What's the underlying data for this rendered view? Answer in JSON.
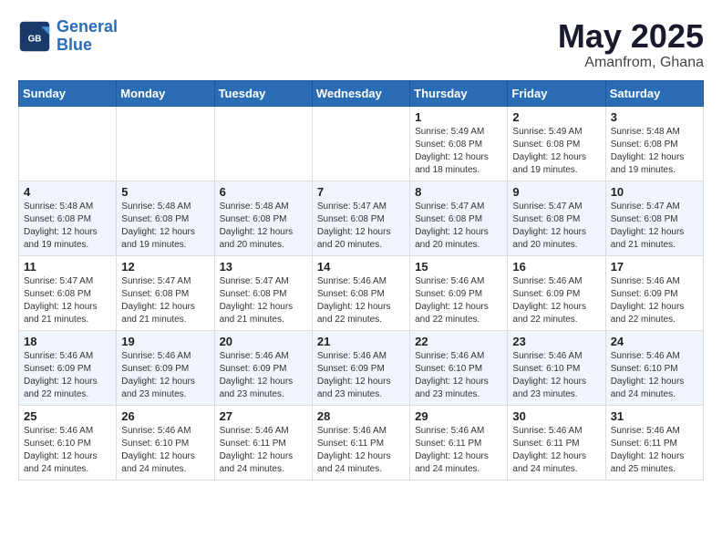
{
  "logo": {
    "line1": "General",
    "line2": "Blue"
  },
  "title": {
    "month_year": "May 2025",
    "location": "Amanfrom, Ghana"
  },
  "weekdays": [
    "Sunday",
    "Monday",
    "Tuesday",
    "Wednesday",
    "Thursday",
    "Friday",
    "Saturday"
  ],
  "weeks": [
    [
      {
        "day": "",
        "info": ""
      },
      {
        "day": "",
        "info": ""
      },
      {
        "day": "",
        "info": ""
      },
      {
        "day": "",
        "info": ""
      },
      {
        "day": "1",
        "info": "Sunrise: 5:49 AM\nSunset: 6:08 PM\nDaylight: 12 hours\nand 18 minutes."
      },
      {
        "day": "2",
        "info": "Sunrise: 5:49 AM\nSunset: 6:08 PM\nDaylight: 12 hours\nand 19 minutes."
      },
      {
        "day": "3",
        "info": "Sunrise: 5:48 AM\nSunset: 6:08 PM\nDaylight: 12 hours\nand 19 minutes."
      }
    ],
    [
      {
        "day": "4",
        "info": "Sunrise: 5:48 AM\nSunset: 6:08 PM\nDaylight: 12 hours\nand 19 minutes."
      },
      {
        "day": "5",
        "info": "Sunrise: 5:48 AM\nSunset: 6:08 PM\nDaylight: 12 hours\nand 19 minutes."
      },
      {
        "day": "6",
        "info": "Sunrise: 5:48 AM\nSunset: 6:08 PM\nDaylight: 12 hours\nand 20 minutes."
      },
      {
        "day": "7",
        "info": "Sunrise: 5:47 AM\nSunset: 6:08 PM\nDaylight: 12 hours\nand 20 minutes."
      },
      {
        "day": "8",
        "info": "Sunrise: 5:47 AM\nSunset: 6:08 PM\nDaylight: 12 hours\nand 20 minutes."
      },
      {
        "day": "9",
        "info": "Sunrise: 5:47 AM\nSunset: 6:08 PM\nDaylight: 12 hours\nand 20 minutes."
      },
      {
        "day": "10",
        "info": "Sunrise: 5:47 AM\nSunset: 6:08 PM\nDaylight: 12 hours\nand 21 minutes."
      }
    ],
    [
      {
        "day": "11",
        "info": "Sunrise: 5:47 AM\nSunset: 6:08 PM\nDaylight: 12 hours\nand 21 minutes."
      },
      {
        "day": "12",
        "info": "Sunrise: 5:47 AM\nSunset: 6:08 PM\nDaylight: 12 hours\nand 21 minutes."
      },
      {
        "day": "13",
        "info": "Sunrise: 5:47 AM\nSunset: 6:08 PM\nDaylight: 12 hours\nand 21 minutes."
      },
      {
        "day": "14",
        "info": "Sunrise: 5:46 AM\nSunset: 6:08 PM\nDaylight: 12 hours\nand 22 minutes."
      },
      {
        "day": "15",
        "info": "Sunrise: 5:46 AM\nSunset: 6:09 PM\nDaylight: 12 hours\nand 22 minutes."
      },
      {
        "day": "16",
        "info": "Sunrise: 5:46 AM\nSunset: 6:09 PM\nDaylight: 12 hours\nand 22 minutes."
      },
      {
        "day": "17",
        "info": "Sunrise: 5:46 AM\nSunset: 6:09 PM\nDaylight: 12 hours\nand 22 minutes."
      }
    ],
    [
      {
        "day": "18",
        "info": "Sunrise: 5:46 AM\nSunset: 6:09 PM\nDaylight: 12 hours\nand 22 minutes."
      },
      {
        "day": "19",
        "info": "Sunrise: 5:46 AM\nSunset: 6:09 PM\nDaylight: 12 hours\nand 23 minutes."
      },
      {
        "day": "20",
        "info": "Sunrise: 5:46 AM\nSunset: 6:09 PM\nDaylight: 12 hours\nand 23 minutes."
      },
      {
        "day": "21",
        "info": "Sunrise: 5:46 AM\nSunset: 6:09 PM\nDaylight: 12 hours\nand 23 minutes."
      },
      {
        "day": "22",
        "info": "Sunrise: 5:46 AM\nSunset: 6:10 PM\nDaylight: 12 hours\nand 23 minutes."
      },
      {
        "day": "23",
        "info": "Sunrise: 5:46 AM\nSunset: 6:10 PM\nDaylight: 12 hours\nand 23 minutes."
      },
      {
        "day": "24",
        "info": "Sunrise: 5:46 AM\nSunset: 6:10 PM\nDaylight: 12 hours\nand 24 minutes."
      }
    ],
    [
      {
        "day": "25",
        "info": "Sunrise: 5:46 AM\nSunset: 6:10 PM\nDaylight: 12 hours\nand 24 minutes."
      },
      {
        "day": "26",
        "info": "Sunrise: 5:46 AM\nSunset: 6:10 PM\nDaylight: 12 hours\nand 24 minutes."
      },
      {
        "day": "27",
        "info": "Sunrise: 5:46 AM\nSunset: 6:11 PM\nDaylight: 12 hours\nand 24 minutes."
      },
      {
        "day": "28",
        "info": "Sunrise: 5:46 AM\nSunset: 6:11 PM\nDaylight: 12 hours\nand 24 minutes."
      },
      {
        "day": "29",
        "info": "Sunrise: 5:46 AM\nSunset: 6:11 PM\nDaylight: 12 hours\nand 24 minutes."
      },
      {
        "day": "30",
        "info": "Sunrise: 5:46 AM\nSunset: 6:11 PM\nDaylight: 12 hours\nand 24 minutes."
      },
      {
        "day": "31",
        "info": "Sunrise: 5:46 AM\nSunset: 6:11 PM\nDaylight: 12 hours\nand 25 minutes."
      }
    ]
  ]
}
